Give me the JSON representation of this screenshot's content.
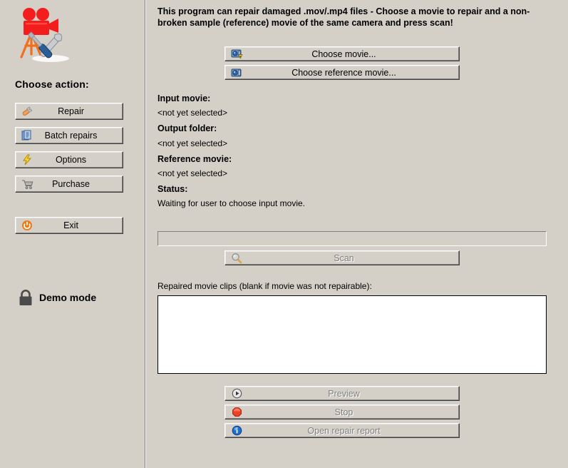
{
  "app": {
    "logo_icon": "movie-camera-repair-icon",
    "background_color": "#d4d0c8"
  },
  "sidebar": {
    "heading": "Choose action:",
    "buttons": [
      {
        "label": "Repair",
        "icon": "wrench-icon",
        "name": "repair-button",
        "enabled": true
      },
      {
        "label": "Batch repairs",
        "icon": "documents-stack-icon",
        "name": "batch-repairs-button",
        "enabled": true
      },
      {
        "label": "Options",
        "icon": "lightning-bolt-icon",
        "name": "options-button",
        "enabled": true
      },
      {
        "label": "Purchase",
        "icon": "shopping-cart-icon",
        "name": "purchase-button",
        "enabled": true
      },
      {
        "label": "Exit",
        "icon": "power-icon",
        "name": "exit-button",
        "enabled": true
      }
    ],
    "status": {
      "label": "Demo mode",
      "icon": "padlock-icon"
    }
  },
  "main": {
    "intro_text": "This program can repair damaged .mov/.mp4 files - Choose a movie to repair and a non-broken sample (reference) movie of the same camera and press scan!",
    "choose_movie_button": {
      "label": "Choose movie...",
      "icon": "camera-warning-icon",
      "enabled": true
    },
    "choose_reference_button": {
      "label": "Choose reference movie...",
      "icon": "camera-icon",
      "enabled": true
    },
    "fields": [
      {
        "label": "Input movie:",
        "value": "<not yet selected>"
      },
      {
        "label": "Output folder:",
        "value": "<not yet selected>"
      },
      {
        "label": "Reference movie:",
        "value": "<not yet selected>"
      }
    ],
    "status": {
      "label": "Status:",
      "value": "Waiting for user to choose input movie."
    },
    "progress": {
      "percent": 0,
      "fill_color": "#0a246a"
    },
    "scan_button": {
      "label": "Scan",
      "icon": "magnifier-icon",
      "enabled": false
    },
    "clips": {
      "label": "Repaired movie clips (blank if movie was not repairable):",
      "items": []
    },
    "bottom_buttons": [
      {
        "label": "Preview",
        "icon": "play-circle-icon",
        "name": "preview-button",
        "enabled": false
      },
      {
        "label": "Stop",
        "icon": "stop-octagon-icon",
        "name": "stop-button",
        "enabled": false
      },
      {
        "label": "Open repair report",
        "icon": "info-circle-icon",
        "name": "report-button",
        "enabled": false
      }
    ]
  }
}
